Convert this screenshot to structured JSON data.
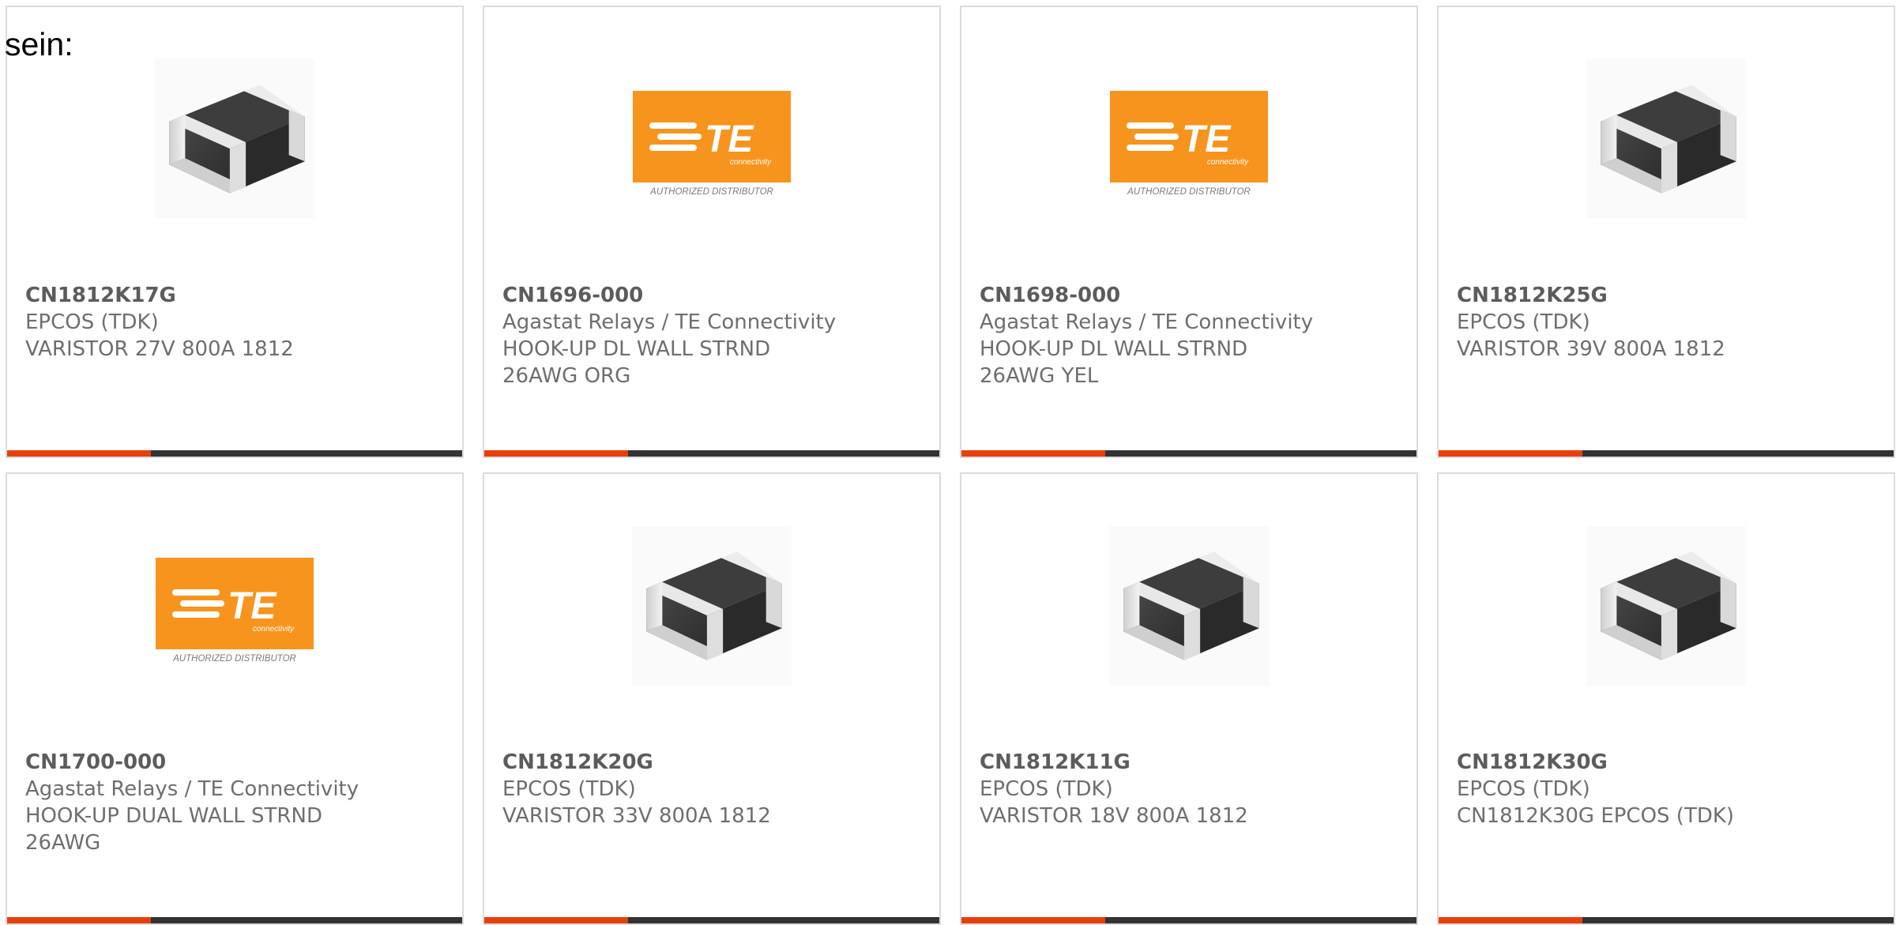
{
  "intro": {
    "text": "sein:"
  },
  "colors": {
    "accent_bar": "#e8400c",
    "dark_bar": "#333333",
    "te_orange": "#f7941d",
    "card_border": "#dcdcdc"
  },
  "products": [
    {
      "part_number": "CN1812K17G",
      "manufacturer": "EPCOS (TDK)",
      "description": [
        "VARISTOR 27V 800A 1812"
      ],
      "image": "smd-varistor-image"
    },
    {
      "part_number": "CN1696-000",
      "manufacturer": "Agastat Relays / TE Connectivity",
      "description": [
        "HOOK-UP DL WALL STRND",
        "26AWG ORG"
      ],
      "image": "te-connectivity-logo",
      "logo_text": {
        "brand": "TE",
        "sub": "connectivity",
        "tag": "AUTHORIZED DISTRIBUTOR"
      }
    },
    {
      "part_number": "CN1698-000",
      "manufacturer": "Agastat Relays / TE Connectivity",
      "description": [
        "HOOK-UP DL WALL STRND",
        "26AWG YEL"
      ],
      "image": "te-connectivity-logo",
      "logo_text": {
        "brand": "TE",
        "sub": "connectivity",
        "tag": "AUTHORIZED DISTRIBUTOR"
      }
    },
    {
      "part_number": "CN1812K25G",
      "manufacturer": "EPCOS (TDK)",
      "description": [
        "VARISTOR 39V 800A 1812"
      ],
      "image": "smd-varistor-image"
    },
    {
      "part_number": "CN1700-000",
      "manufacturer": "Agastat Relays / TE Connectivity",
      "description": [
        "HOOK-UP DUAL WALL STRND",
        "26AWG"
      ],
      "image": "te-connectivity-logo",
      "logo_text": {
        "brand": "TE",
        "sub": "connectivity",
        "tag": "AUTHORIZED DISTRIBUTOR"
      }
    },
    {
      "part_number": "CN1812K20G",
      "manufacturer": "EPCOS (TDK)",
      "description": [
        "VARISTOR 33V 800A 1812"
      ],
      "image": "smd-varistor-image"
    },
    {
      "part_number": "CN1812K11G",
      "manufacturer": "EPCOS (TDK)",
      "description": [
        "VARISTOR 18V 800A 1812"
      ],
      "image": "smd-varistor-image"
    },
    {
      "part_number": "CN1812K30G",
      "manufacturer": "EPCOS (TDK)",
      "description": [
        "CN1812K30G EPCOS (TDK)"
      ],
      "image": "smd-varistor-image"
    }
  ]
}
